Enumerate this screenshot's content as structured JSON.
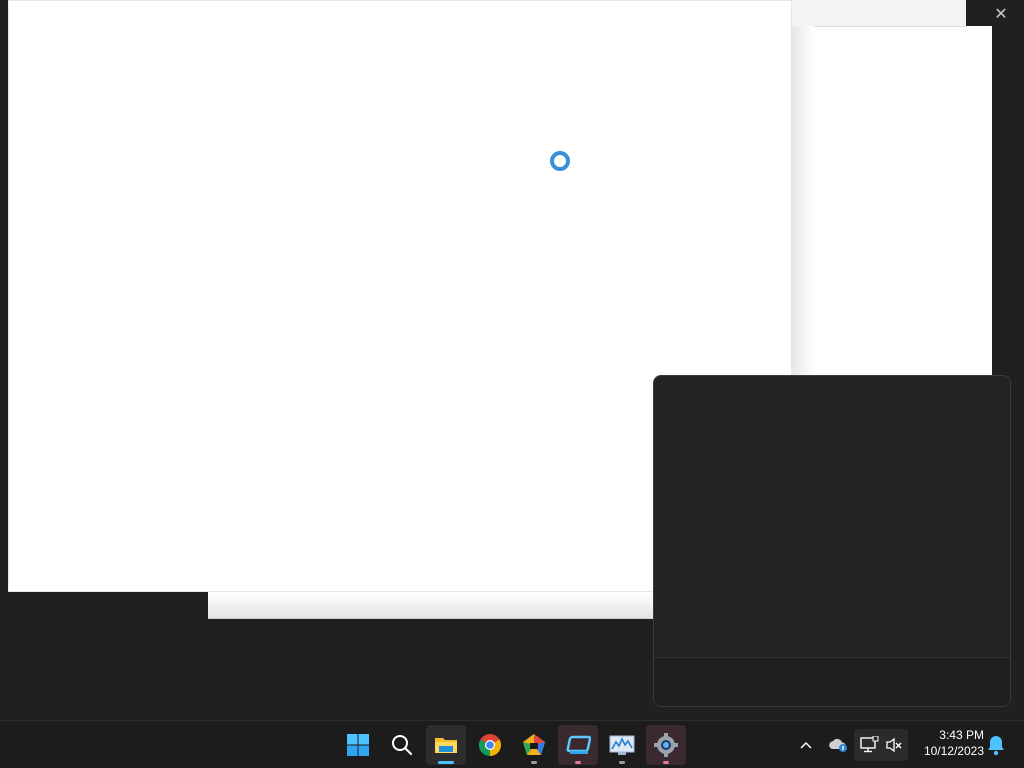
{
  "clock": {
    "time": "3:43 PM",
    "date": "10/12/2023"
  },
  "taskbar": {
    "apps": [
      {
        "name": "start",
        "icon": "windows-logo-icon"
      },
      {
        "name": "search",
        "icon": "search-icon"
      },
      {
        "name": "file-explorer",
        "icon": "folder-icon",
        "state": "active"
      },
      {
        "name": "chrome",
        "icon": "chrome-icon"
      },
      {
        "name": "app-pentagon",
        "icon": "pentagon-app-icon",
        "state": "running"
      },
      {
        "name": "app-blue",
        "icon": "blue-app-icon",
        "state": "running"
      },
      {
        "name": "app-monitor",
        "icon": "monitor-chart-icon",
        "state": "running"
      },
      {
        "name": "settings",
        "icon": "gear-icon",
        "state": "running"
      }
    ],
    "tray": [
      "chevron-up-icon",
      "onedrive-icon",
      "network-icon",
      "volume-muted-icon",
      "bell-icon"
    ]
  },
  "colors": {
    "accent": "#4cc2ff",
    "taskbar": "#1c1c1c",
    "flyout": "#232323",
    "spinner": "#3b8fd8"
  }
}
